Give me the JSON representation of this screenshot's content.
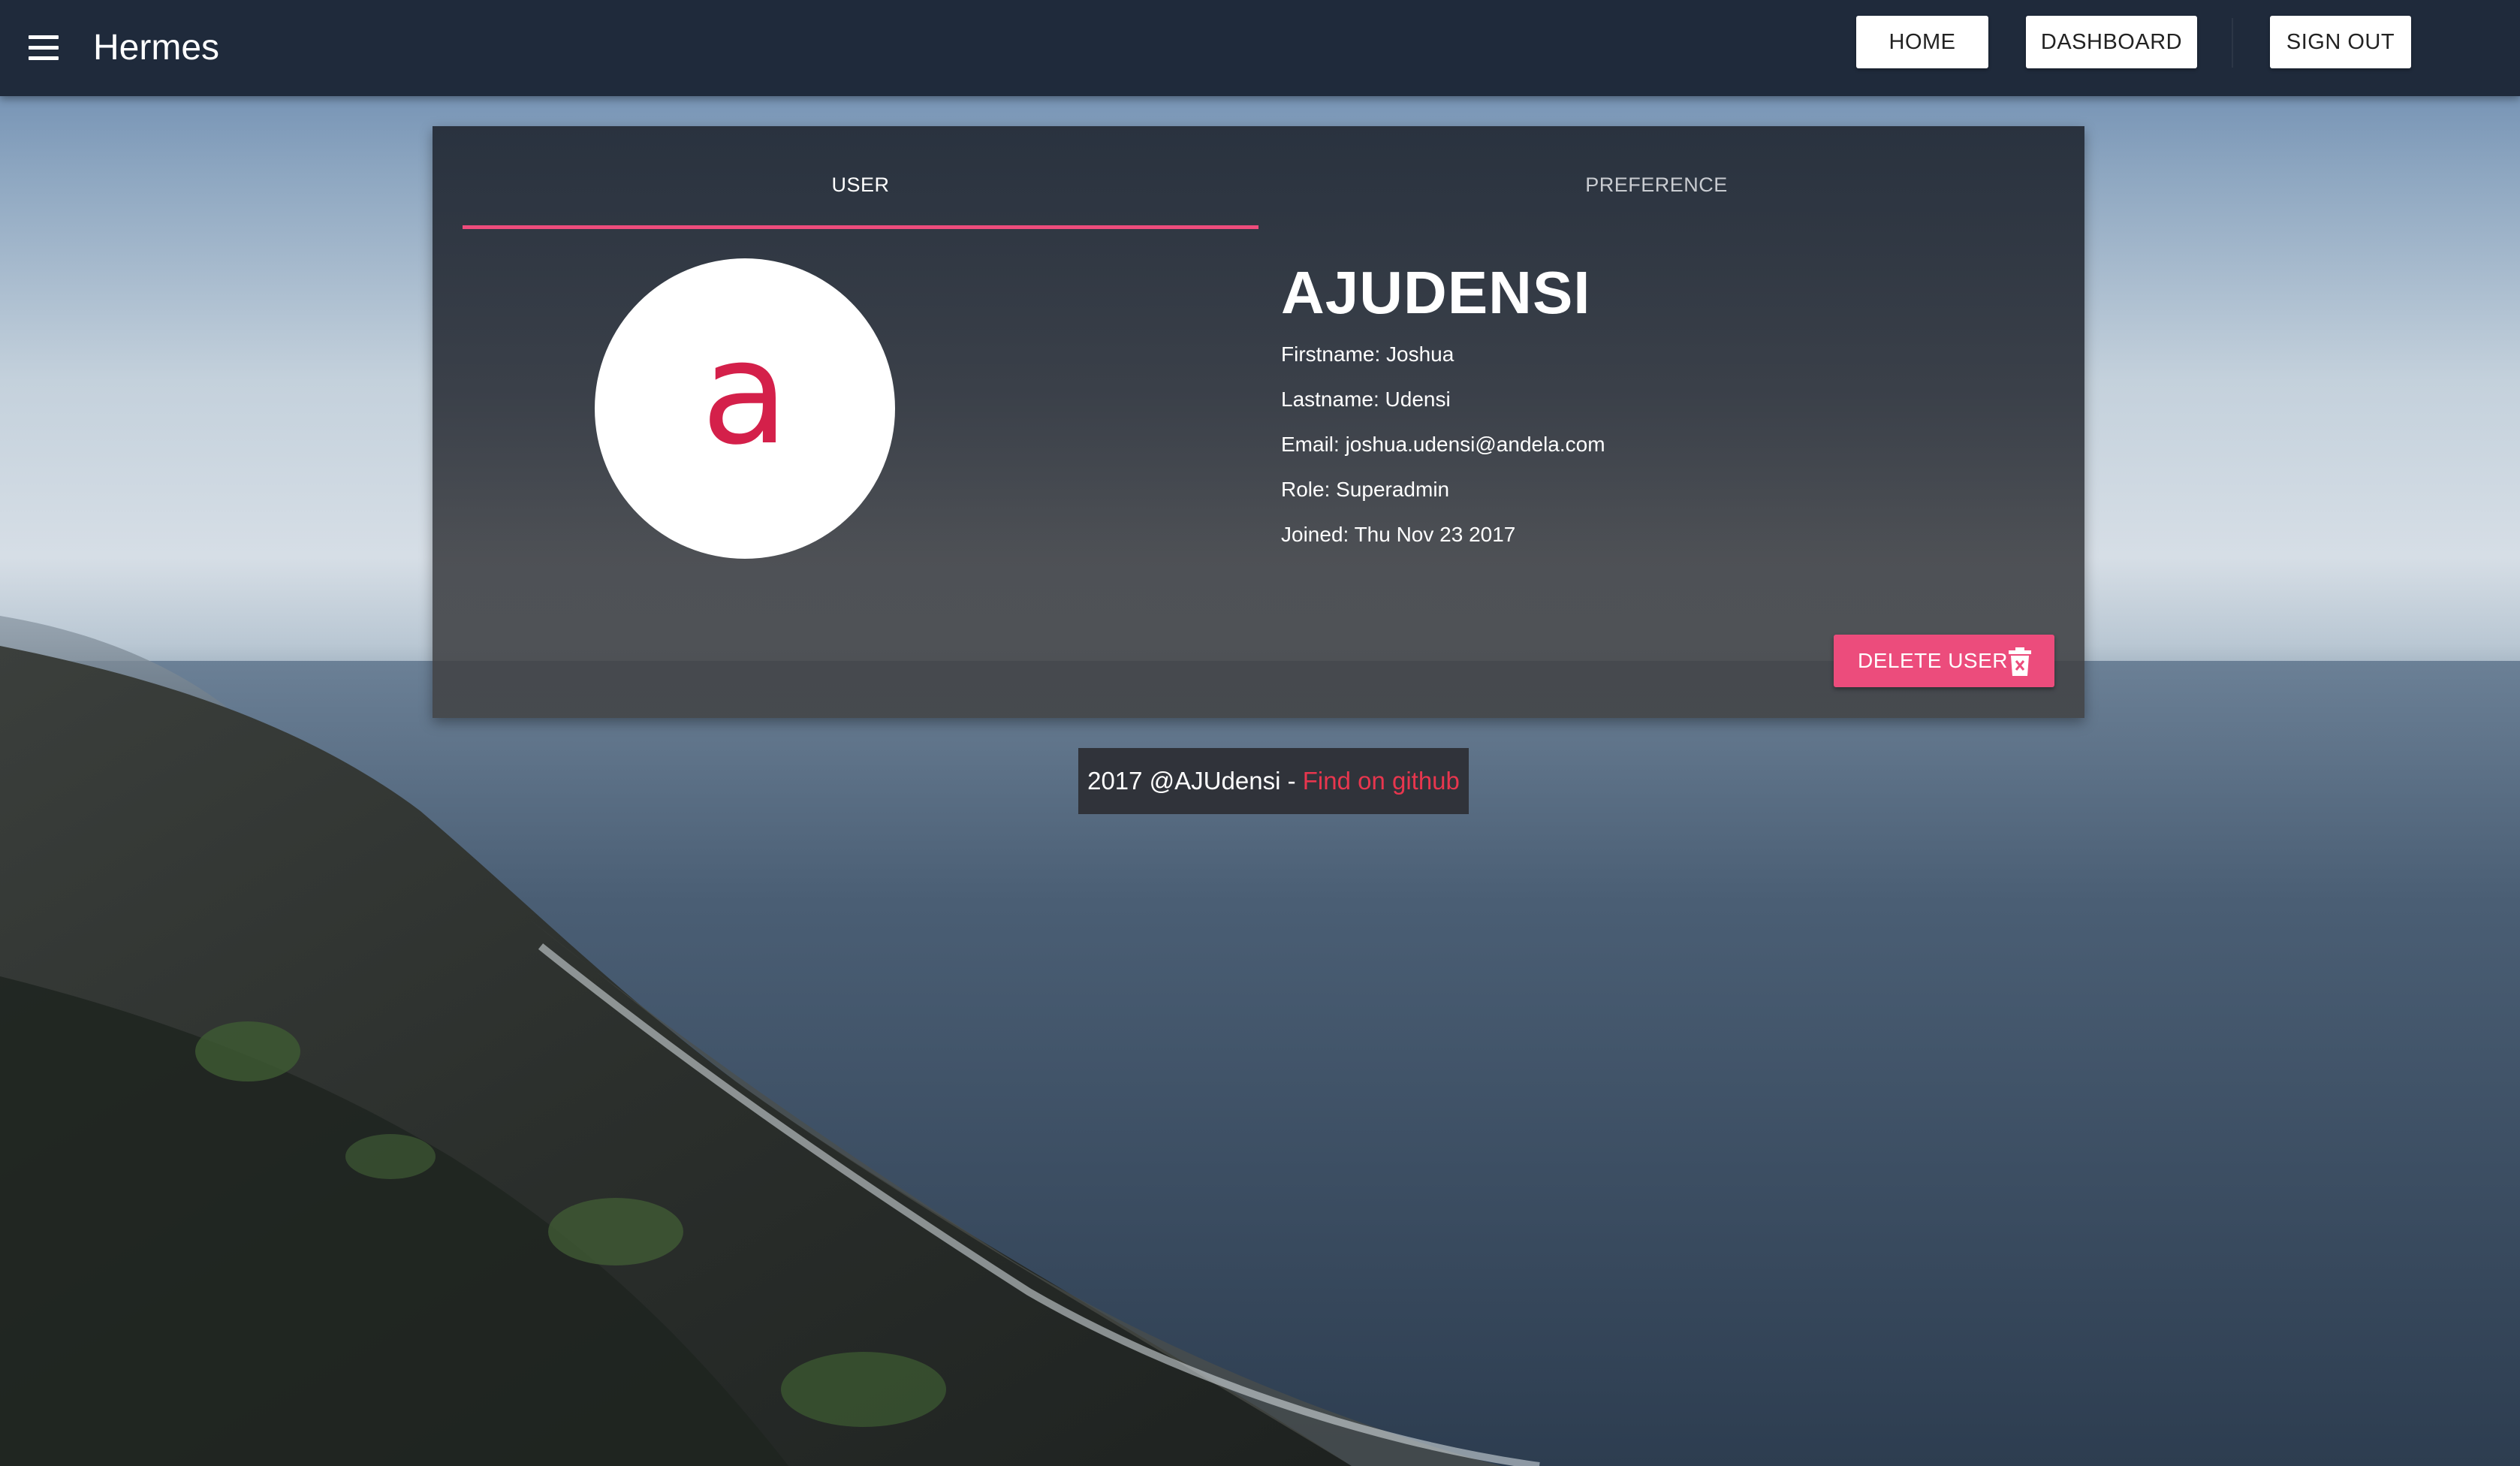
{
  "appbar": {
    "title": "Hermes",
    "menu_icon": "hamburger-menu-icon",
    "nav": {
      "home_label": "HOME",
      "dashboard_label": "DASHBOARD",
      "signout_label": "SIGN OUT"
    }
  },
  "profile": {
    "tabs": [
      {
        "label": "USER",
        "active": true
      },
      {
        "label": "PREFERENCE",
        "active": false
      }
    ],
    "avatar_letter": "a",
    "username": "AJUDENSI",
    "fields": {
      "firstname": "Firstname: Joshua",
      "lastname": "Lastname: Udensi",
      "email": "Email: joshua.udensi@andela.com",
      "role": "Role: Superadmin",
      "joined": "Joined: Thu Nov 23 2017"
    },
    "delete_label": "DELETE USER",
    "delete_icon": "trash-icon"
  },
  "footer": {
    "text": "2017 @AJUdensi - ",
    "link_text": "Find on github"
  },
  "colors": {
    "appbar": "#1f2a3b",
    "accent_pink": "#ec4c7c",
    "avatar_letter": "#d4204a",
    "footer_link": "#e8364e"
  }
}
